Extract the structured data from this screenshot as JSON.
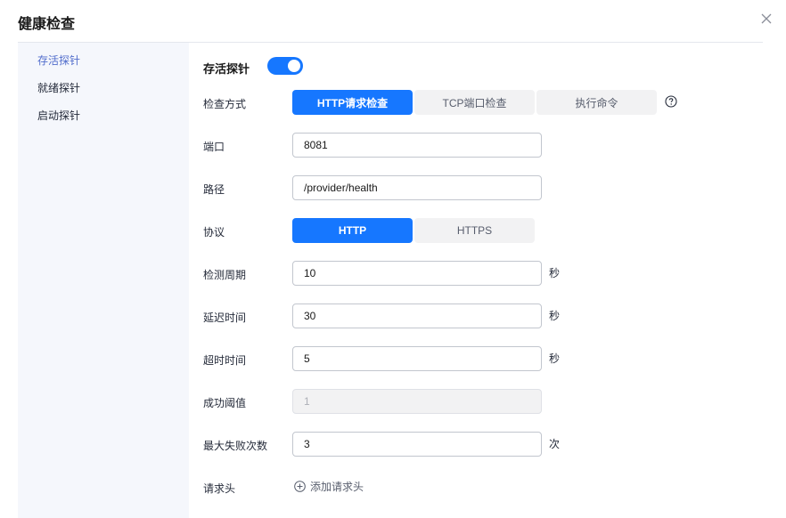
{
  "dialog": {
    "title": "健康检查"
  },
  "nav": {
    "items": [
      "存活探针",
      "就绪探针",
      "启动探针"
    ],
    "active_index": 0
  },
  "probe": {
    "section_title": "存活探针",
    "enabled": true,
    "check_method": {
      "label": "检查方式",
      "options": [
        "HTTP请求检查",
        "TCP端口检查",
        "执行命令"
      ],
      "selected": "HTTP请求检查"
    },
    "port": {
      "label": "端口",
      "value": "8081"
    },
    "path": {
      "label": "路径",
      "value": "/provider/health"
    },
    "protocol": {
      "label": "协议",
      "options": [
        "HTTP",
        "HTTPS"
      ],
      "selected": "HTTP"
    },
    "period": {
      "label": "检测周期",
      "value": "10",
      "unit": "秒"
    },
    "delay": {
      "label": "延迟时间",
      "value": "30",
      "unit": "秒"
    },
    "timeout": {
      "label": "超时时间",
      "value": "5",
      "unit": "秒"
    },
    "success_threshold": {
      "label": "成功阈值",
      "value": "1",
      "disabled": true
    },
    "max_failures": {
      "label": "最大失败次数",
      "value": "3",
      "unit": "次"
    },
    "request_headers": {
      "label": "请求头",
      "add_label": "添加请求头"
    }
  },
  "colors": {
    "primary": "#1677ff",
    "nav_active": "#526ecc",
    "nav_bg": "#f5f7fc"
  },
  "icons": {
    "close": "close-icon",
    "help": "help-circle-icon",
    "add": "plus-circle-icon"
  }
}
